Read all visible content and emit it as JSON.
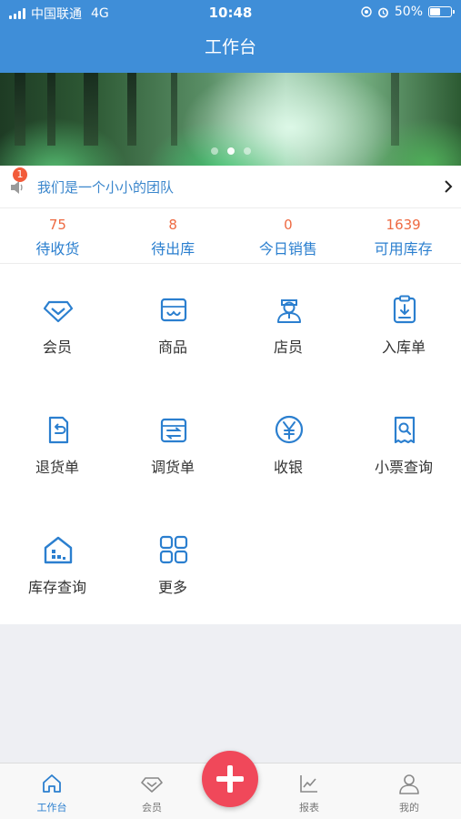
{
  "status": {
    "carrier": "中国联通",
    "network": "4G",
    "time": "10:48",
    "battery": "50%",
    "battery_level": 0.5
  },
  "header": {
    "title": "工作台"
  },
  "banner": {
    "slides": 3,
    "active_slide": 2
  },
  "notice": {
    "badge": "1",
    "text": "我们是一个小小的团队"
  },
  "stats": [
    {
      "value": "75",
      "label": "待收货"
    },
    {
      "value": "8",
      "label": "待出库"
    },
    {
      "value": "0",
      "label": "今日销售"
    },
    {
      "value": "1639",
      "label": "可用库存"
    }
  ],
  "menu": [
    {
      "label": "会员",
      "icon": "diamond-icon"
    },
    {
      "label": "商品",
      "icon": "product-box-icon"
    },
    {
      "label": "店员",
      "icon": "clerk-icon"
    },
    {
      "label": "入库单",
      "icon": "stock-in-clipboard-icon"
    },
    {
      "label": "退货单",
      "icon": "return-order-icon"
    },
    {
      "label": "调货单",
      "icon": "transfer-order-icon"
    },
    {
      "label": "收银",
      "icon": "yen-cashier-icon"
    },
    {
      "label": "小票查询",
      "icon": "receipt-search-icon"
    },
    {
      "label": "库存查询",
      "icon": "warehouse-icon"
    },
    {
      "label": "更多",
      "icon": "grid-more-icon"
    }
  ],
  "tabs": [
    {
      "label": "工作台",
      "icon": "home-icon",
      "active": true
    },
    {
      "label": "会员",
      "icon": "diamond-icon",
      "active": false
    },
    {
      "label": "报表",
      "icon": "chart-icon",
      "active": false
    },
    {
      "label": "我的",
      "icon": "user-icon",
      "active": false
    }
  ],
  "colors": {
    "primary": "#3f8ed8",
    "accent_number": "#ee6a42",
    "fab": "#f0485a"
  }
}
